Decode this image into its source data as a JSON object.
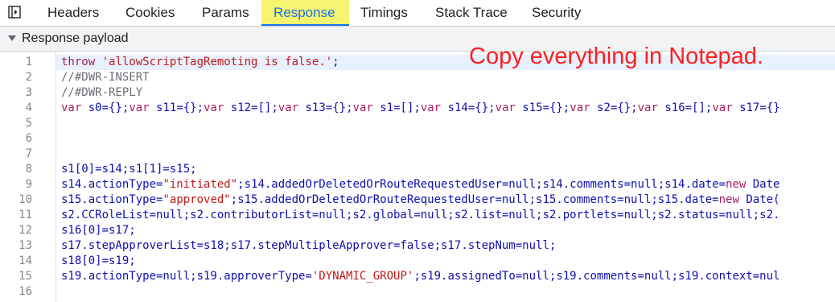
{
  "tabs": [
    {
      "label": "Headers",
      "active": false
    },
    {
      "label": "Cookies",
      "active": false
    },
    {
      "label": "Params",
      "active": false
    },
    {
      "label": "Response",
      "active": true
    },
    {
      "label": "Timings",
      "active": false
    },
    {
      "label": "Stack Trace",
      "active": false
    },
    {
      "label": "Security",
      "active": false
    }
  ],
  "toolbar_icon": "toggle-panel-icon",
  "section": {
    "label": "Response payload",
    "expanded": true,
    "caret_icon": "caret-down-icon"
  },
  "annotation": "Copy everything in Notepad.",
  "colors": {
    "active_tab_bg": "#f6f370",
    "annotation": "#ff1d1d",
    "highlight_line_bg": "#e8f0fe"
  },
  "code_lines": [
    {
      "n": "1",
      "text": "throw 'allowScriptTagRemoting is false.';",
      "highlighted": true
    },
    {
      "n": "2",
      "text": "//#DWR-INSERT"
    },
    {
      "n": "3",
      "text": "//#DWR-REPLY"
    },
    {
      "n": "4",
      "text": "var s0={};var s11={};var s12=[];var s13={};var s1=[];var s14={};var s15={};var s2={};var s16=[];var s17={}"
    },
    {
      "n": "5",
      "text": ""
    },
    {
      "n": "6",
      "text": ""
    },
    {
      "n": "7",
      "text": ""
    },
    {
      "n": "8",
      "text": "s1[0]=s14;s1[1]=s15;"
    },
    {
      "n": "9",
      "text": "s14.actionType=\"initiated\";s14.addedOrDeletedOrRouteRequestedUser=null;s14.comments=null;s14.date=new Date"
    },
    {
      "n": "10",
      "text": "s15.actionType=\"approved\";s15.addedOrDeletedOrRouteRequestedUser=null;s15.comments=null;s15.date=new Date("
    },
    {
      "n": "11",
      "text": "s2.CCRoleList=null;s2.contributorList=null;s2.global=null;s2.list=null;s2.portlets=null;s2.status=null;s2."
    },
    {
      "n": "12",
      "text": "s16[0]=s17;"
    },
    {
      "n": "13",
      "text": "s17.stepApproverList=s18;s17.stepMultipleApprover=false;s17.stepNum=null;"
    },
    {
      "n": "14",
      "text": "s18[0]=s19;"
    },
    {
      "n": "15",
      "text": "s19.actionType=null;s19.approverType='DYNAMIC_GROUP';s19.assignedTo=null;s19.comments=null;s19.context=nul"
    },
    {
      "n": "16",
      "text": ""
    }
  ]
}
